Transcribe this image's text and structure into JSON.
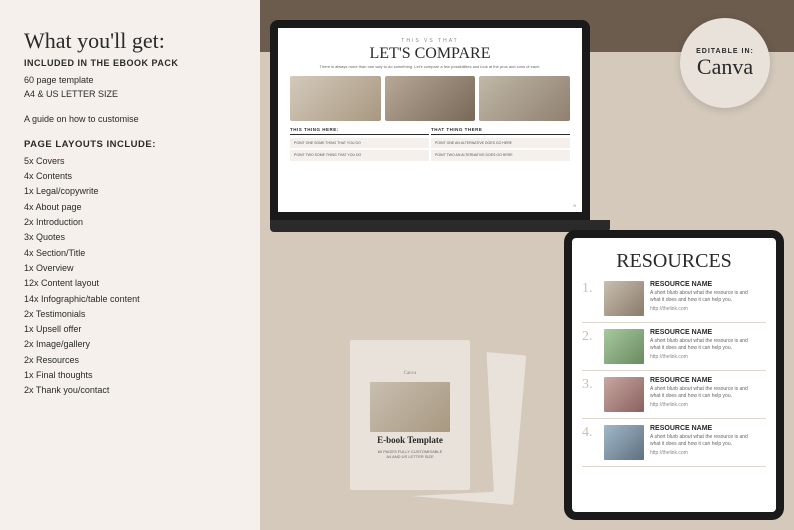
{
  "headline": "What you'll get:",
  "included_label": "Included in THE EBOOK PACK",
  "page_count": "60 page template",
  "size_info": "A4 & US LETTER SIZE",
  "guide_text": "A guide on how to customise",
  "layouts_title": "PAGE LAYOUTS INCLUDE:",
  "layouts": [
    "5x Covers",
    "4x Contents",
    "1x Legal/copywrite",
    "4x About page",
    "2x Introduction",
    "3x Quotes",
    "4x Section/Title",
    "1x Overview",
    "12x Content layout",
    "14x Infographic/table content",
    "2x Testimonials",
    "1x Upsell offer",
    "2x Image/gallery",
    "2x Resources",
    "1x Final thoughts",
    "2x Thank you/contact"
  ],
  "canva_badge": {
    "top_text": "EDITABLE IN:",
    "main_text": "Canva"
  },
  "compare_page": {
    "subtitle": "THIS VS THAT",
    "title": "LET'S COMPARE",
    "body": "There is always more than one way to do something. Let's compare a few\npossibilities and look at the pros and cons of each.",
    "col1_header": "THIS THING HERE:",
    "col2_header": "THAT THING THERE",
    "col1_items": [
      "POINT ONE SOME THING\nTHAT YOU DO",
      "POINT TWO SOME THING\nTHAT YOU DO"
    ],
    "col2_items": [
      "POINT ONE AN ALTERNATIVE\nDOES GO HERE",
      "POINT TWO AN ALTERNATIVE\nDOES GO HERE"
    ],
    "page_number": "/5"
  },
  "ebook_cover": {
    "label": "Canva",
    "title": "E-book\nTemplate",
    "sub": "60 PAGES\nFULLY CUSTOMISABLE",
    "size": "A4 AND US LETTER SIZE"
  },
  "resources_page": {
    "title": "RESOURCES",
    "items": [
      {
        "number": "1.",
        "name": "RESOURCE NAME",
        "desc": "A short blurb about what the\nresource is and what it does\nand how it can help you.",
        "link": "http://thelink.com"
      },
      {
        "number": "2.",
        "name": "RESOURCE NAME",
        "desc": "A short blurb about what the\nresource is and what it does\nand how it can help you.",
        "link": "http://thelink.com"
      },
      {
        "number": "3.",
        "name": "RESOURCE NAME",
        "desc": "A short blurb about what the\nresource is and what it does\nand how it can help you.",
        "link": "http://thelink.com"
      },
      {
        "number": "4.",
        "name": "RESOURCE NAME",
        "desc": "A short blurb about what the\nresource is and what it does\nand how it can help you.",
        "link": "http://thelink.com"
      }
    ]
  }
}
